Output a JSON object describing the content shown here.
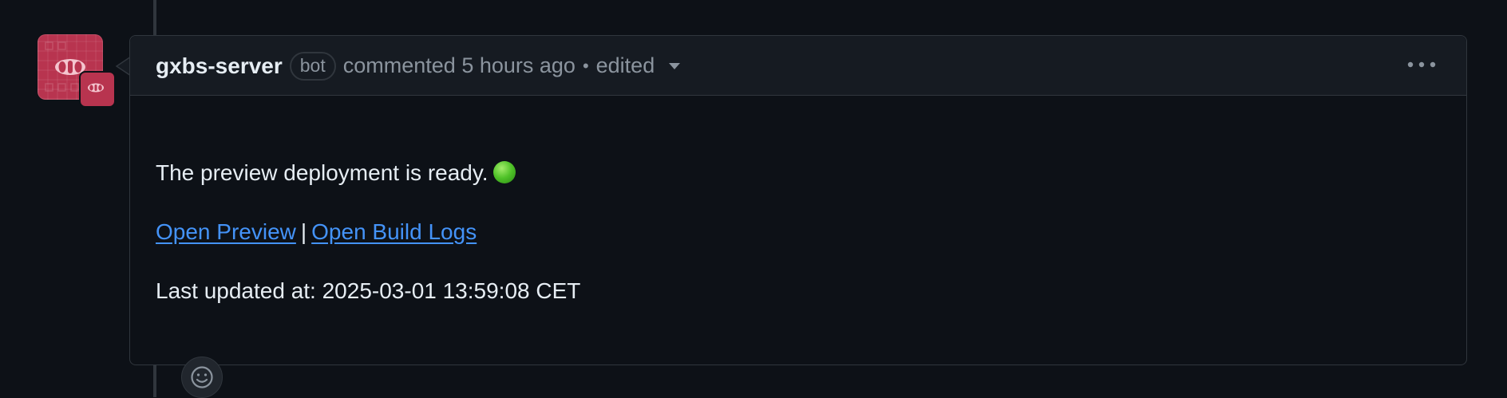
{
  "comment": {
    "author": "gxbs-server",
    "author_badge": "bot",
    "action_text": "commented 5 hours ago",
    "separator": "•",
    "edited_label": "edited",
    "body": {
      "status_text": "The preview deployment is ready.",
      "status_icon": "green-circle-emoji",
      "links": {
        "preview": "Open Preview",
        "divider": "|",
        "build_logs": "Open Build Logs"
      },
      "last_updated": "Last updated at: 2025-03-01 13:59:08 CET"
    }
  },
  "icons": {
    "avatar": "gxbs-server-avatar",
    "more_options": "kebab-horizontal-icon",
    "edited_dropdown": "triangle-down-icon",
    "reaction": "smiley-icon"
  },
  "colors": {
    "background": "#0d1117",
    "header_background": "#161b22",
    "border": "#30363d",
    "text_primary": "#e6edf3",
    "text_muted": "#8b949e",
    "link": "#4493f8",
    "avatar": "#b8344f",
    "status_green": "#4fc228"
  }
}
